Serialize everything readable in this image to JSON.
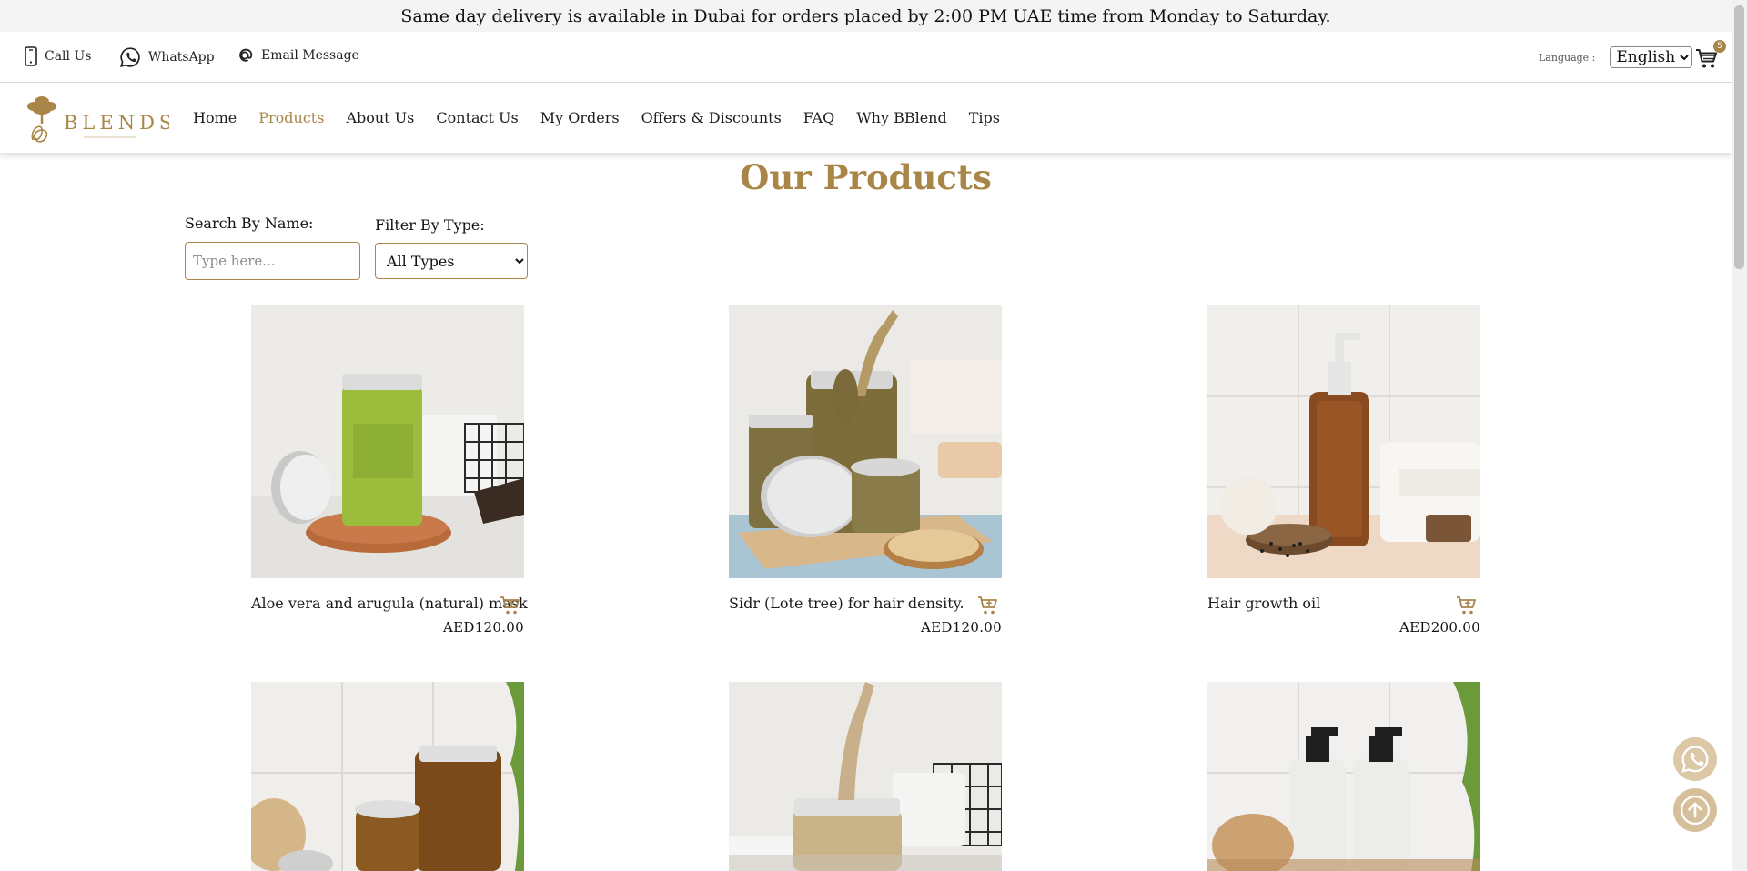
{
  "announcement": "Same day delivery is available in Dubai for orders placed by 2:00 PM UAE time from Monday to Saturday.",
  "contact": {
    "call": "Call Us",
    "whatsapp": "WhatsApp",
    "email": "Email Message",
    "language_label": "Language :",
    "language_value": "English",
    "cart_count": "5"
  },
  "brand": {
    "logo_text": "BLENDS",
    "accent": "#a98548"
  },
  "nav": {
    "home": "Home",
    "products": "Products",
    "about": "About Us",
    "contact": "Contact Us",
    "orders": "My Orders",
    "offers": "Offers & Discounts",
    "faq": "FAQ",
    "why": "Why BBlend",
    "tips": "Tips"
  },
  "page": {
    "title": "Our Products",
    "search_label": "Search By Name:",
    "search_placeholder": "Type here...",
    "filter_label": "Filter By Type:",
    "filter_value": "All Types"
  },
  "products": [
    {
      "name": "Aloe vera and arugula (natural) mask",
      "price": "AED120.00"
    },
    {
      "name": "Sidr (Lote tree) for hair density.",
      "price": "AED120.00"
    },
    {
      "name": "Hair growth oil",
      "price": "AED200.00"
    }
  ]
}
